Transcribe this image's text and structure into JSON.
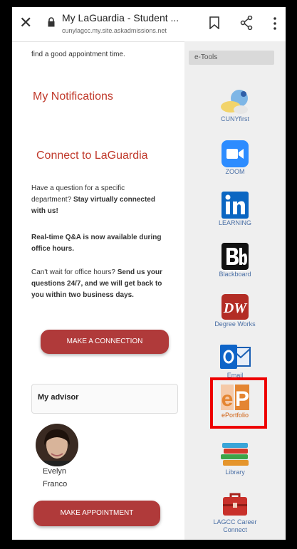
{
  "browser": {
    "page_title": "My LaGuardia - Student ...",
    "url": "cunylagcc.my.site.askadmissions.net"
  },
  "main": {
    "intro_fragment": "find a good appointment time.",
    "notifications_heading": "My Notifications",
    "connect_heading": "Connect to LaGuardia",
    "question_text": "Have a question for a specific department?",
    "question_bold": "Stay virtually connected with us!",
    "qa_bold": "Real-time Q&A is now available during office hours.",
    "wait_text": "Can't wait for office hours?",
    "wait_bold": "Send us your questions 24/7, and we will get back to you within two business days.",
    "connect_button": "MAKE A CONNECTION",
    "advisor_label": "My advisor",
    "advisor_first": "Evelyn",
    "advisor_last": "Franco",
    "appointment_button": "MAKE APPOINTMENT"
  },
  "etools": {
    "header": "e-Tools",
    "items": [
      {
        "label": "CUNYfirst",
        "icon": "cunyfirst-icon"
      },
      {
        "label": "ZOOM",
        "icon": "zoom-icon"
      },
      {
        "label": "LEARNING",
        "icon": "linkedin-learning-icon"
      },
      {
        "label": "Blackboard",
        "icon": "blackboard-icon"
      },
      {
        "label": "Degree Works",
        "icon": "degree-works-icon"
      },
      {
        "label": "Email",
        "icon": "outlook-email-icon"
      },
      {
        "label": "ePortfolio",
        "icon": "eportfolio-icon"
      },
      {
        "label": "Library",
        "icon": "library-books-icon"
      },
      {
        "label": "LAGCC Career Connect",
        "icon": "career-briefcase-icon"
      }
    ]
  },
  "colors": {
    "accent": "#b03a3a",
    "heading_red": "#c0392b",
    "tool_label": "#4a6fa5",
    "highlight_box": "#ee0000"
  }
}
